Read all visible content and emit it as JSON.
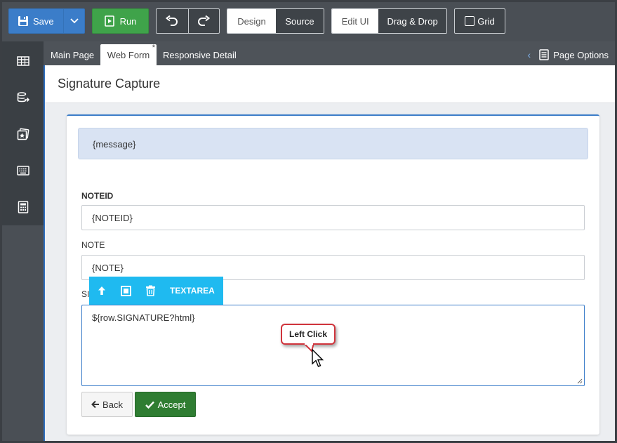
{
  "toolbar": {
    "save_label": "Save",
    "run_label": "Run",
    "design_label": "Design",
    "source_label": "Source",
    "edit_ui_label": "Edit UI",
    "drag_drop_label": "Drag & Drop",
    "grid_label": "Grid"
  },
  "sidebar": {
    "items": [
      {
        "icon": "table-icon"
      },
      {
        "icon": "database-export-icon"
      },
      {
        "icon": "gallery-icon"
      },
      {
        "icon": "keyboard-icon"
      },
      {
        "icon": "calculator-icon"
      }
    ]
  },
  "tabs": {
    "main_page": "Main Page",
    "web_form": "Web Form",
    "web_form_modified": "*",
    "responsive_detail": "Responsive Detail",
    "page_options": "Page Options"
  },
  "page": {
    "title": "Signature Capture",
    "message": "{message}",
    "fields": {
      "noteid_label": "NOTEID",
      "noteid_value": "{NOTEID}",
      "note_label": "NOTE",
      "note_value": "{NOTE}",
      "signature_label_partial": "SI",
      "signature_value": "${row.SIGNATURE?html}"
    },
    "back_label": "Back",
    "accept_label": "Accept"
  },
  "element_toolbar": {
    "element_type": "TEXTAREA"
  },
  "callout": {
    "text": "Left Click"
  },
  "colors": {
    "save": "#3b7dc9",
    "run": "#3fa34a",
    "accept": "#2f7d32",
    "element_toolbar": "#1fbaf0",
    "callout_border": "#d0343c"
  }
}
